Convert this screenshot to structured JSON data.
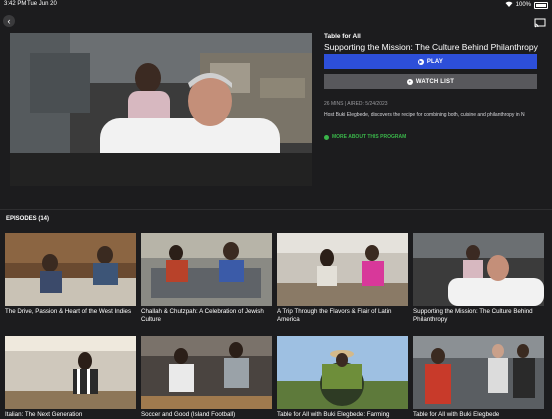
{
  "status": {
    "time": "3:42 PM",
    "date": "Tue Jun 20",
    "battery": "100%"
  },
  "show": {
    "label": "Table for All",
    "title": "Supporting the Mission: The Culture Behind Philanthropy",
    "play_label": "PLAY",
    "watchlist_label": "WATCH LIST",
    "meta": "26 MINS | AIRED: 5/24/2023",
    "description": "Host Buki Elegbede, discovers the recipe for combining both, cuisine and philanthropy in N",
    "more_label": "MORE ABOUT THIS PROGRAM"
  },
  "episodes_label": "EPISODES (14)",
  "episodes": [
    {
      "title": "The Drive, Passion & Heart of the West Indies"
    },
    {
      "title": "Challah & Chutzpah: A Celebration of Jewish Culture"
    },
    {
      "title": "A Trip Through the Flavors & Flair of Latin America"
    },
    {
      "title": "Supporting the Mission: The Culture Behind Philanthropy"
    },
    {
      "title": "Italian: The Next Generation"
    },
    {
      "title": "Soccer and Good (Island Football)"
    },
    {
      "title": "Table for All with Buki Elegbede: Farming"
    },
    {
      "title": "Table for All with Buki Elegbede"
    }
  ],
  "colors": {
    "accent": "#2d4fd9",
    "secondary": "#58585c",
    "link": "#3ab54a"
  }
}
